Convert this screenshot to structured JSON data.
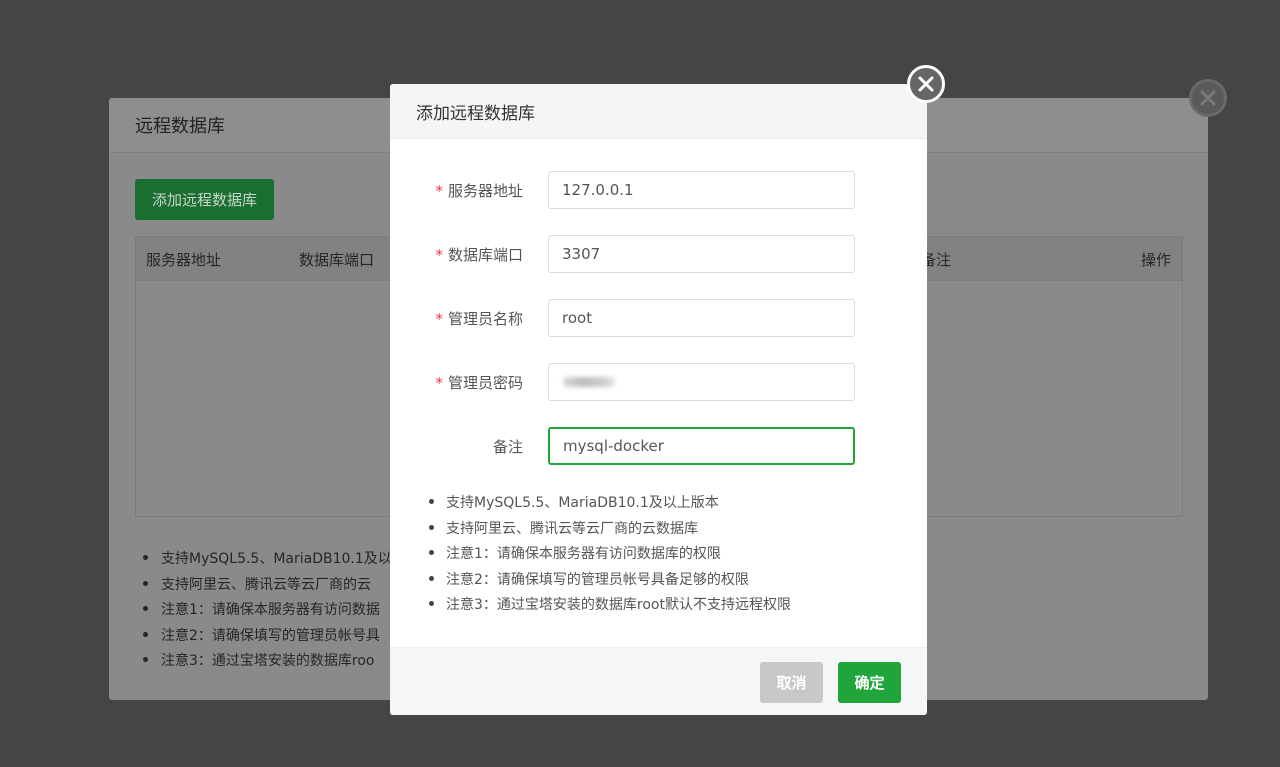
{
  "background_panel": {
    "title": "远程数据库",
    "add_button_label": "添加远程数据库",
    "table_columns": [
      "服务器地址",
      "数据库端口",
      "备注",
      "操作"
    ],
    "notes": [
      "支持MySQL5.5、MariaDB10.1及以",
      "支持阿里云、腾讯云等云厂商的云",
      "注意1：请确保本服务器有访问数据",
      "注意2：请确保填写的管理员帐号具",
      "注意3：通过宝塔安装的数据库roo"
    ]
  },
  "modal": {
    "title": "添加远程数据库",
    "fields": [
      {
        "label": "服务器地址",
        "required": "*",
        "value": "127.0.0.1"
      },
      {
        "label": "数据库端口",
        "required": "*",
        "value": "3307"
      },
      {
        "label": "管理员名称",
        "required": "*",
        "value": "root"
      },
      {
        "label": "管理员密码",
        "required": "*",
        "value": ""
      },
      {
        "label": "备注",
        "required": "",
        "value": "mysql-docker"
      }
    ],
    "notes": [
      "支持MySQL5.5、MariaDB10.1及以上版本",
      "支持阿里云、腾讯云等云厂商的云数据库",
      "注意1：请确保本服务器有访问数据库的权限",
      "注意2：请确保填写的管理员帐号具备足够的权限",
      "注意3：通过宝塔安装的数据库root默认不支持远程权限"
    ],
    "cancel_label": "取消",
    "confirm_label": "确定"
  },
  "colors": {
    "accent": "#20a53a",
    "required": "#e03c3c",
    "overlay": "#454545"
  },
  "icons": {
    "modal_close": "close-circle-icon",
    "background_close": "close-circle-icon"
  }
}
